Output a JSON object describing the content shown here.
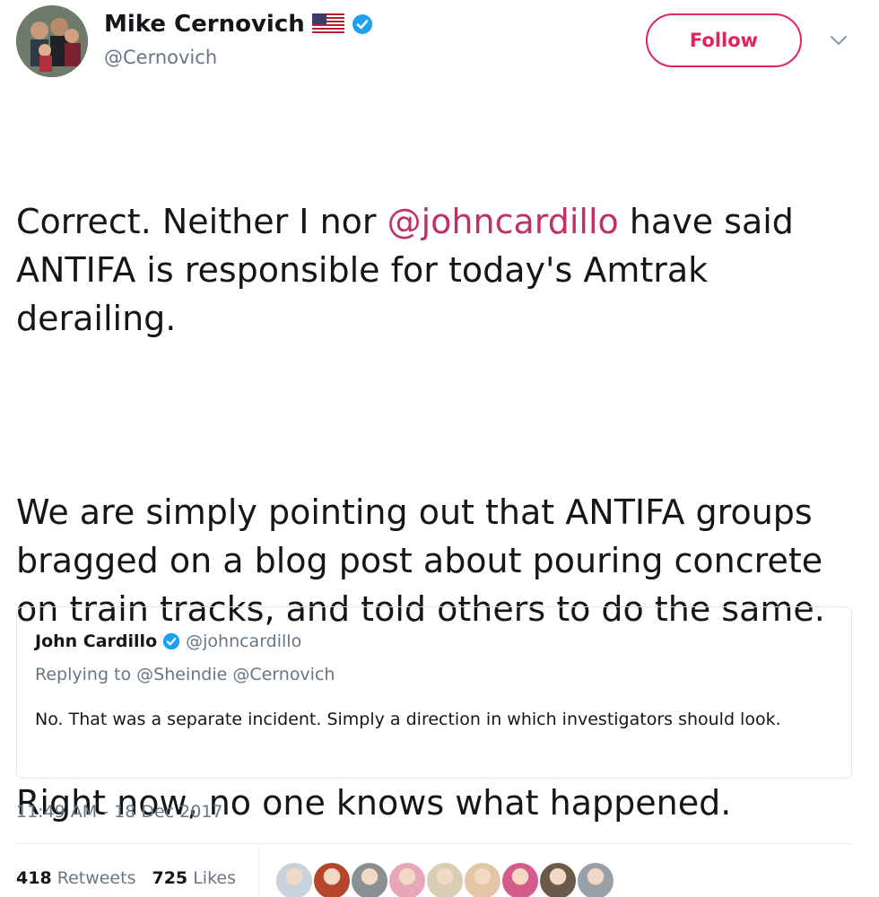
{
  "author": {
    "display_name": "Mike Cernovich",
    "handle": "@Cernovich",
    "flag_icon": "us-flag-icon",
    "verified_icon": "verified-badge-icon"
  },
  "actions": {
    "follow_label": "Follow",
    "menu_icon": "chevron-down-icon"
  },
  "tweet": {
    "line1_pre": "Correct. Neither I nor ",
    "mention": "@johncardillo",
    "line1_post": " have said ANTIFA is responsible for today's Amtrak derailing.",
    "para2": "We are simply pointing out that ANTIFA groups bragged on a blog post about pouring concrete on train tracks, and told others to do the same.",
    "para3": "Right now, no one knows what happened."
  },
  "quoted_tweet": {
    "display_name": "John Cardillo",
    "handle": "@johncardillo",
    "replying_to": "Replying to @Sheindie @Cernovich",
    "text": "No. That was a separate incident. Simply a direction in which investigators should look."
  },
  "meta": {
    "timestamp": "11:49 AM - 18 Dec 2017"
  },
  "stats": {
    "retweets_count": "418",
    "retweets_label": "Retweets",
    "likes_count": "725",
    "likes_label": "Likes"
  },
  "likers": [
    {
      "color": "#c9d1dc"
    },
    {
      "color": "#b5452b"
    },
    {
      "color": "#8a8f93"
    },
    {
      "color": "#e8a7b8"
    },
    {
      "color": "#d9cdb3"
    },
    {
      "color": "#e3c6a6"
    },
    {
      "color": "#d45b8a"
    },
    {
      "color": "#6b5a4a"
    },
    {
      "color": "#9aa1a6"
    }
  ],
  "colors": {
    "accent": "#e0245e",
    "mention": "#c03168",
    "verified": "#1da1f2",
    "secondary_text": "#657786"
  }
}
